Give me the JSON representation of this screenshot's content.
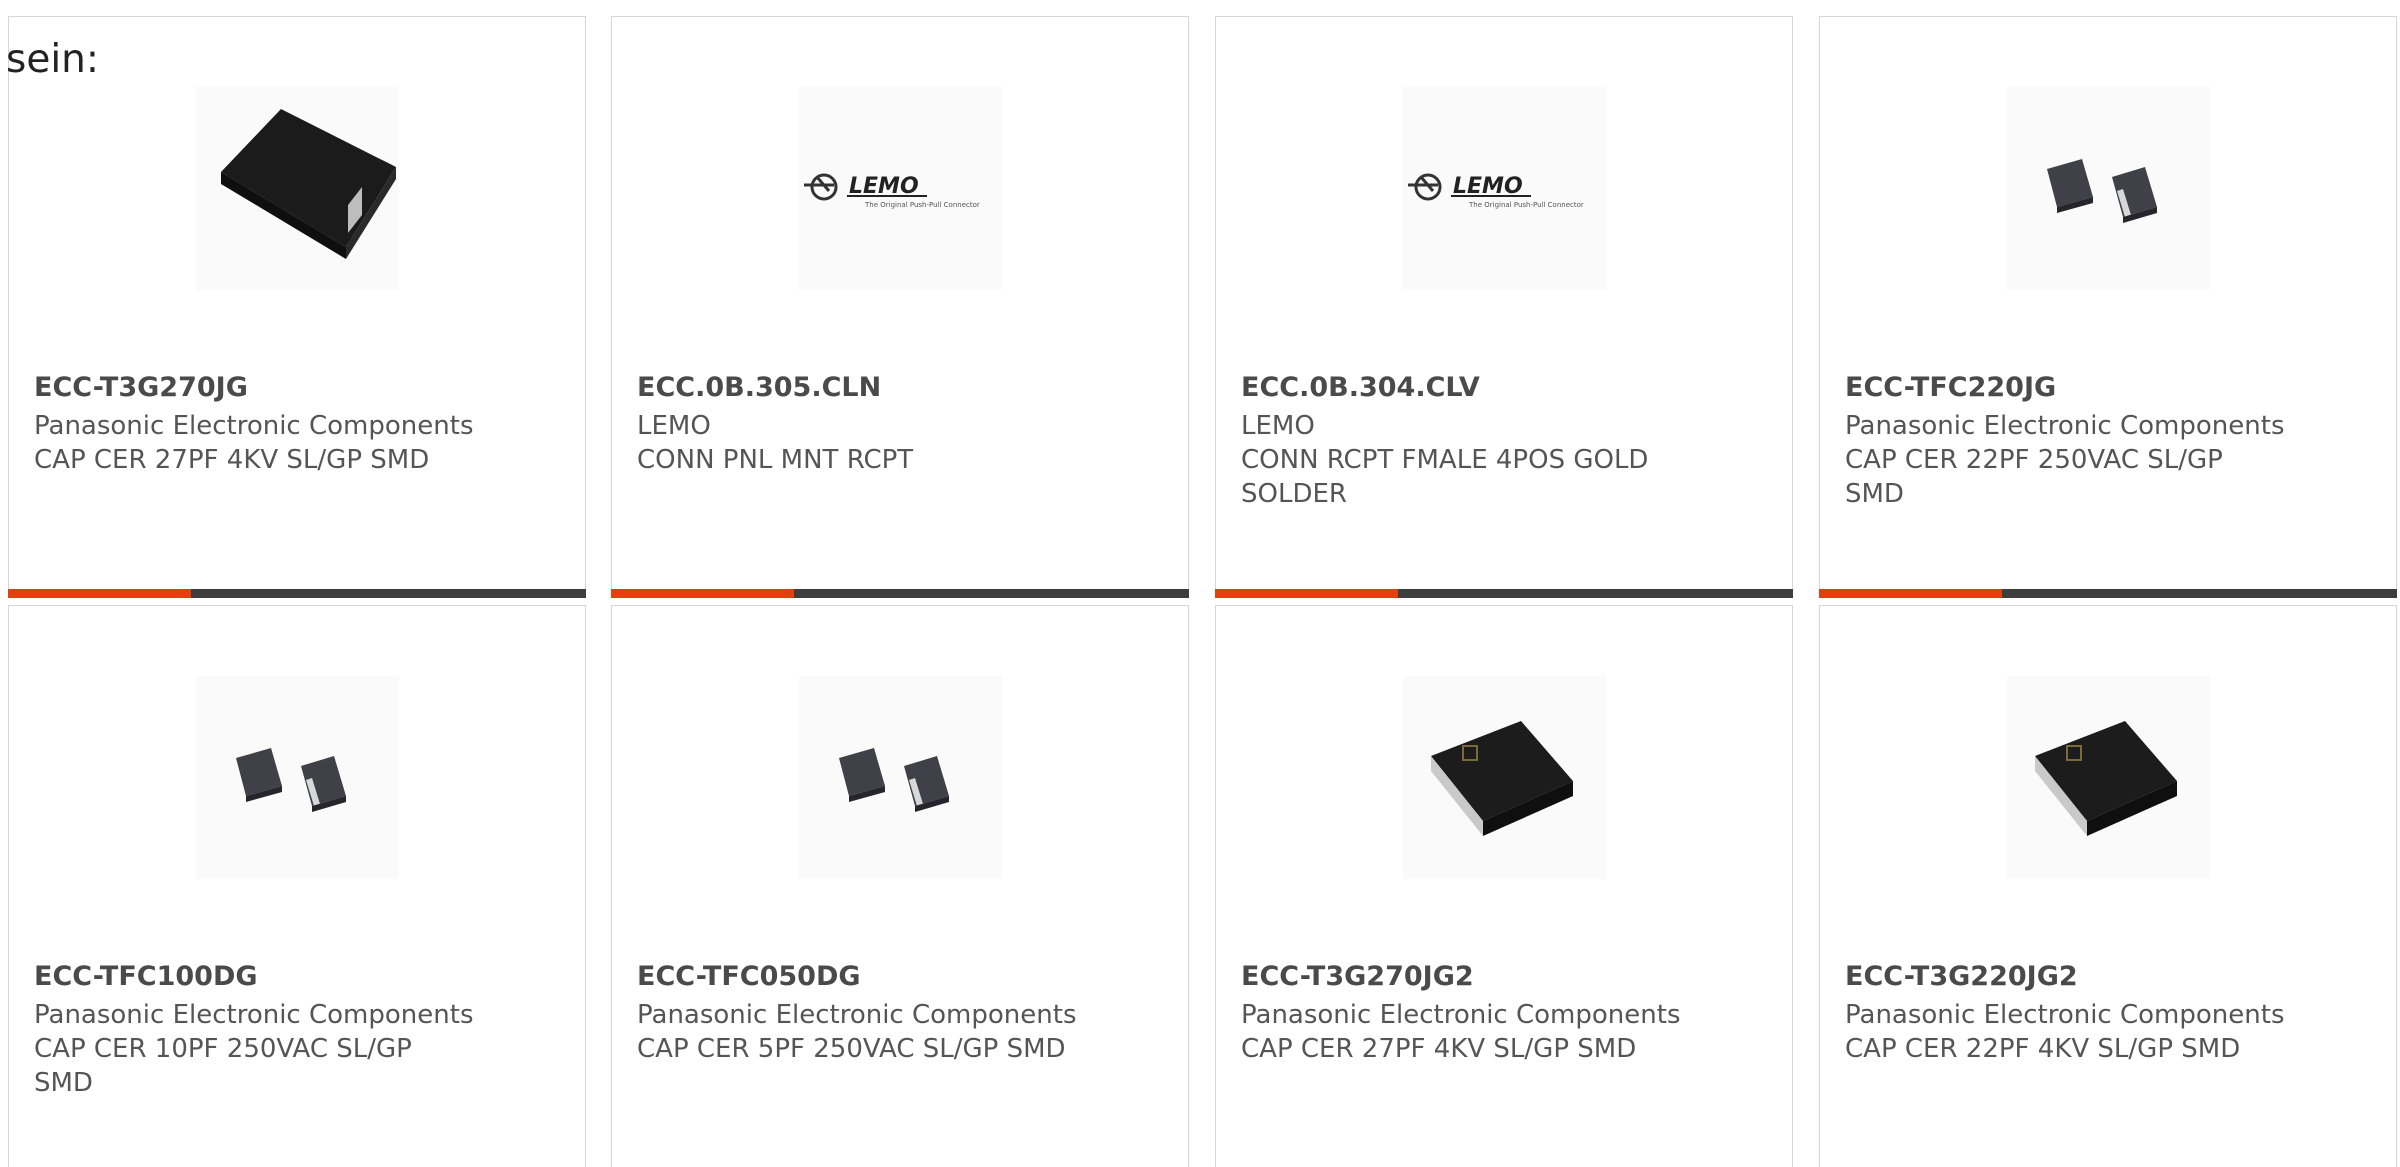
{
  "lead_text": "sein:",
  "colors": {
    "accent": "#e0410f",
    "bar": "#3e3e3e"
  },
  "products": [
    {
      "part_number": "ECC-T3G270JG",
      "manufacturer": "Panasonic Electronic Components",
      "description": "CAP CER 27PF 4KV SL/GP SMD",
      "image": "black-smd-capacitor"
    },
    {
      "part_number": "ECC.0B.305.CLN",
      "manufacturer": "LEMO",
      "description": "CONN PNL MNT RCPT",
      "image": "lemo-logo"
    },
    {
      "part_number": "ECC.0B.304.CLV",
      "manufacturer": "LEMO",
      "description": "CONN RCPT FMALE 4POS GOLD SOLDER",
      "image": "lemo-logo"
    },
    {
      "part_number": "ECC-TFC220JG",
      "manufacturer": "Panasonic Electronic Components",
      "description": "CAP CER 22PF 250VAC SL/GP SMD",
      "image": "two-small-smd-capacitors"
    },
    {
      "part_number": "ECC-TFC100DG",
      "manufacturer": "Panasonic Electronic Components",
      "description": "CAP CER 10PF 250VAC SL/GP SMD",
      "image": "two-small-smd-capacitors"
    },
    {
      "part_number": "ECC-TFC050DG",
      "manufacturer": "Panasonic Electronic Components",
      "description": "CAP CER 5PF 250VAC SL/GP SMD",
      "image": "two-small-smd-capacitors"
    },
    {
      "part_number": "ECC-T3G270JG2",
      "manufacturer": "Panasonic Electronic Components",
      "description": "CAP CER 27PF 4KV SL/GP SMD",
      "image": "black-smd-capacitor-marked"
    },
    {
      "part_number": "ECC-T3G220JG2",
      "manufacturer": "Panasonic Electronic Components",
      "description": "CAP CER 22PF 4KV SL/GP SMD",
      "image": "black-smd-capacitor-marked"
    }
  ]
}
